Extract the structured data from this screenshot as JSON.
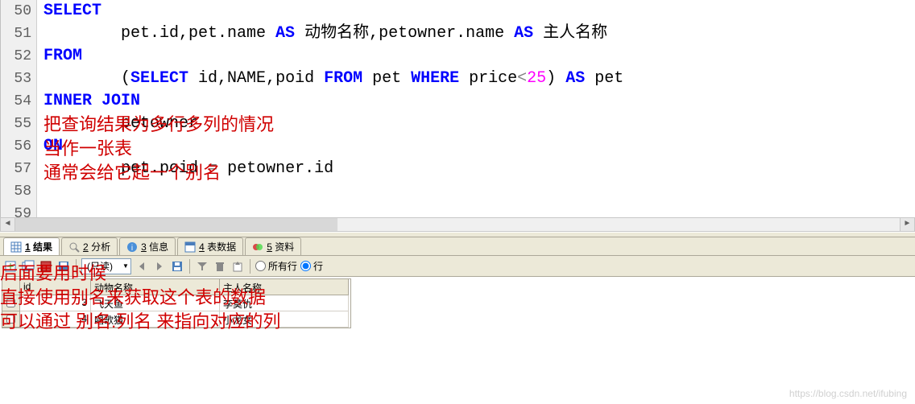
{
  "code": {
    "lines": [
      50,
      51,
      52,
      53,
      54,
      55,
      56,
      57,
      58,
      59
    ],
    "l50": "SELECT",
    "l51_pre": "        pet.id,pet.name ",
    "l51_as1": "AS",
    "l51_mid": " 动物名称,petowner.name ",
    "l51_as2": "AS",
    "l51_post": " 主人名称",
    "l52": "FROM",
    "l53_pre": "        (",
    "l53_sel": "SELECT",
    "l53_a": " id,NAME,poid ",
    "l53_from": "FROM",
    "l53_b": " pet ",
    "l53_where": "WHERE",
    "l53_c": " price",
    "l53_op": "<",
    "l53_num": "25",
    "l53_d": ") ",
    "l53_as": "AS",
    "l53_e": " pet",
    "l54": "INNER JOIN",
    "l55": "        petowner",
    "l56": "ON",
    "l57_a": "        pet.poid ",
    "l57_op": "=",
    "l57_b": " petowner.id"
  },
  "annotations": {
    "a1_l1": "把查询结果为多行多列的情况",
    "a1_l2": "当作一张表",
    "a1_l3": "通常会给它起一个别名",
    "a2_l1": "后面要用时候",
    "a2_l2": "直接使用别名来获取这个表的数据",
    "a2_l3": "可以通过 别名.列名 来指向对应的列"
  },
  "tabs": {
    "t1_num": "1",
    "t1_label": "结果",
    "t2_num": "2",
    "t2_label": "分析",
    "t3_num": "3",
    "t3_label": "信息",
    "t4_num": "4",
    "t4_label": "表数据",
    "t5_num": "5",
    "t5_label": "资料"
  },
  "toolbar": {
    "mode": "(只读)",
    "opt_all": "所有行",
    "opt_row": "行"
  },
  "grid": {
    "h_id": "id",
    "h_name": "动物名称",
    "h_owner": "主人名称",
    "r1_id": "3",
    "r1_name": "飞天鱼",
    "r1_owner": "李莫仇",
    "r2_id": "4",
    "r2_name": "唱歌猫",
    "r2_owner": "小龙女"
  },
  "watermark": "https://blog.csdn.net/ifubing"
}
